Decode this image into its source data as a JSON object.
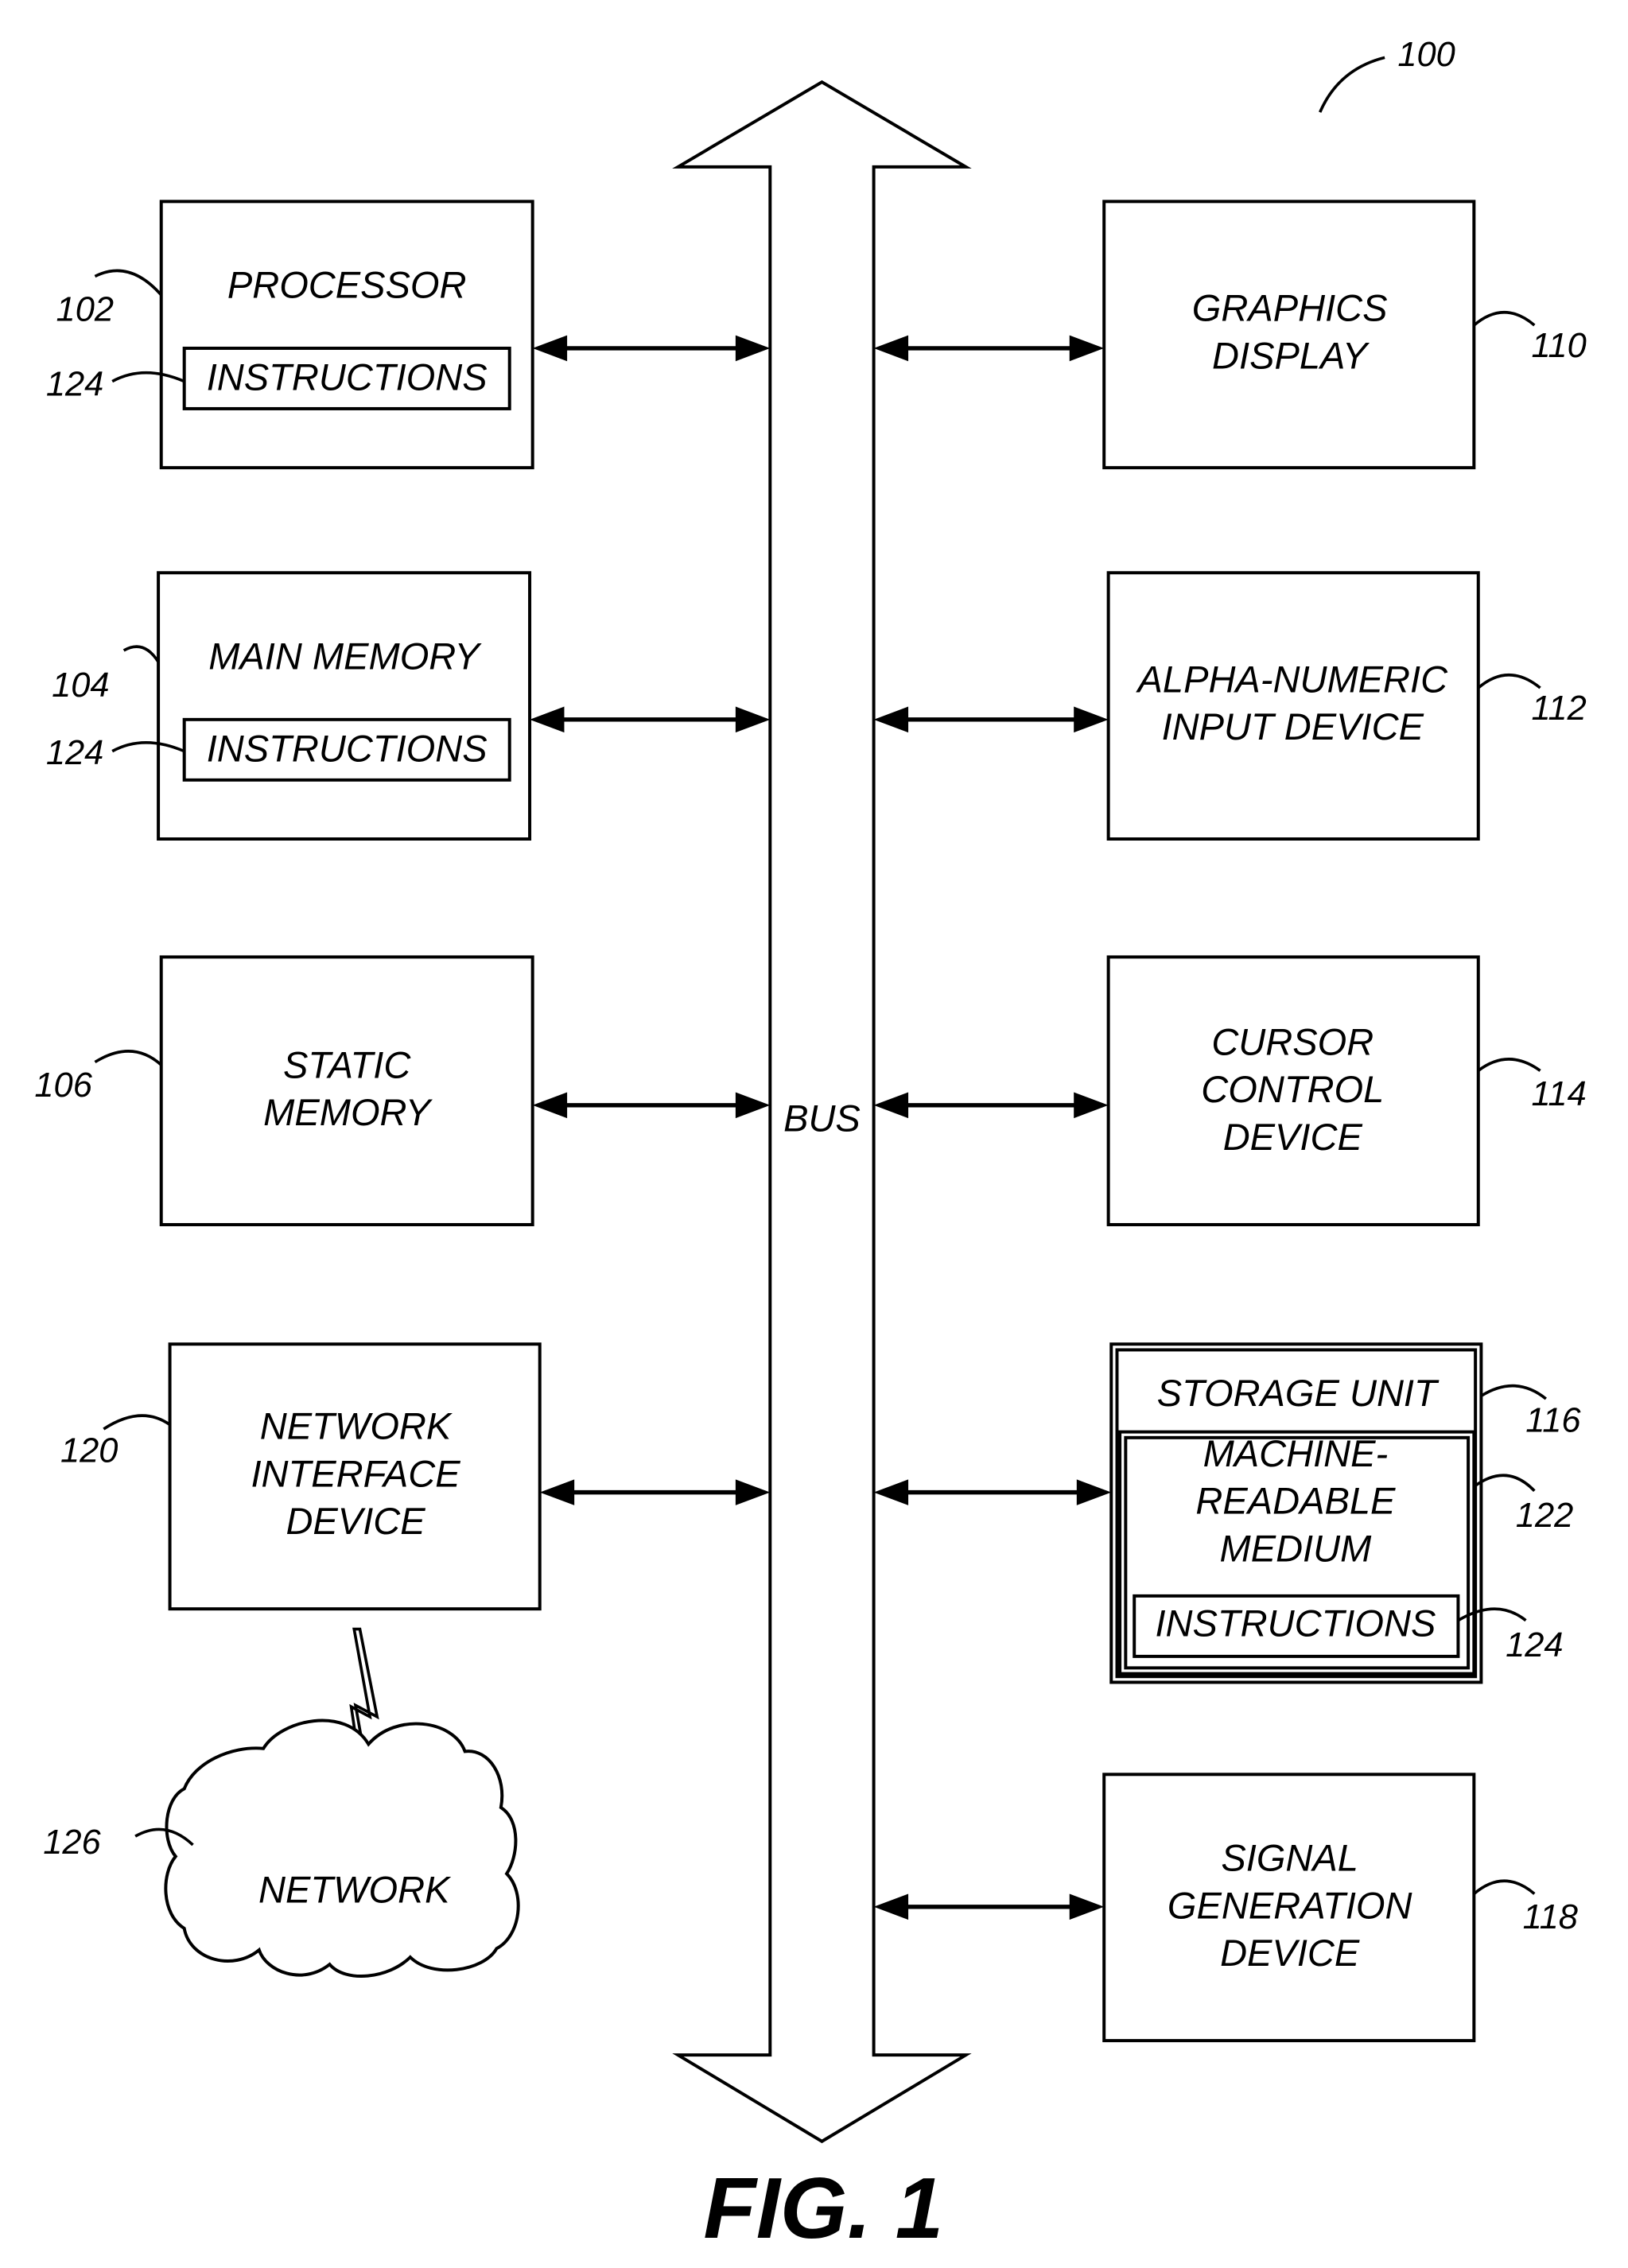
{
  "figure": {
    "title": "FIG. 1",
    "ref": "100",
    "bus_label": "BUS"
  },
  "left_blocks": [
    {
      "id": "processor",
      "lines": [
        "PROCESSOR"
      ],
      "ref": "102",
      "inner": {
        "label": "INSTRUCTIONS",
        "ref": "124"
      }
    },
    {
      "id": "main-memory",
      "lines": [
        "MAIN MEMORY"
      ],
      "ref": "104",
      "inner": {
        "label": "INSTRUCTIONS",
        "ref": "124"
      }
    },
    {
      "id": "static-memory",
      "lines": [
        "STATIC",
        "MEMORY"
      ],
      "ref": "106"
    },
    {
      "id": "network-interface-device",
      "lines": [
        "NETWORK",
        "INTERFACE",
        "DEVICE"
      ],
      "ref": "120"
    }
  ],
  "right_blocks": [
    {
      "id": "graphics-display",
      "lines": [
        "GRAPHICS",
        "DISPLAY"
      ],
      "ref": "110"
    },
    {
      "id": "alpha-numeric-input-device",
      "lines": [
        "ALPHA-NUMERIC",
        "INPUT DEVICE"
      ],
      "ref": "112"
    },
    {
      "id": "cursor-control-device",
      "lines": [
        "CURSOR",
        "CONTROL",
        "DEVICE"
      ],
      "ref": "114"
    },
    {
      "id": "storage-unit",
      "lines": [
        "STORAGE UNIT"
      ],
      "ref": "116",
      "medium": {
        "lines": [
          "MACHINE-",
          "READABLE",
          "MEDIUM"
        ],
        "ref": "122"
      },
      "inner": {
        "label": "INSTRUCTIONS",
        "ref": "124"
      }
    },
    {
      "id": "signal-generation-device",
      "lines": [
        "SIGNAL",
        "GENERATION",
        "DEVICE"
      ],
      "ref": "118"
    }
  ],
  "network": {
    "label": "NETWORK",
    "ref": "126"
  }
}
